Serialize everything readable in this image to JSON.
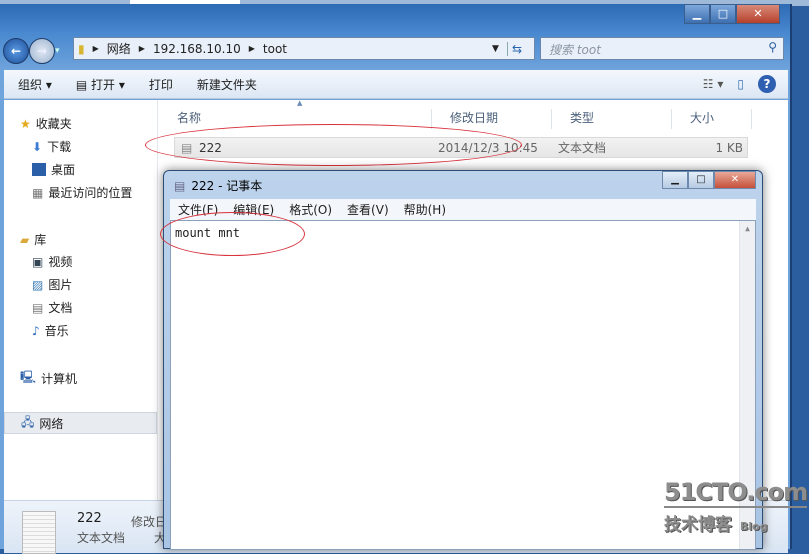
{
  "explorer": {
    "breadcrumb": [
      "网络",
      "192.168.10.10",
      "toot"
    ],
    "search_placeholder": "搜索 toot",
    "toolbar": {
      "organize": "组织 ▾",
      "open": "打开 ▾",
      "print": "打印",
      "new_folder": "新建文件夹"
    },
    "sidebar": {
      "favorites": "收藏夹",
      "downloads": "下载",
      "desktop": "桌面",
      "recent": "最近访问的位置",
      "libraries": "库",
      "videos": "视频",
      "pictures": "图片",
      "documents": "文档",
      "music": "音乐",
      "computer": "计算机",
      "network": "网络"
    },
    "columns": {
      "name": "名称",
      "modified": "修改日期",
      "type": "类型",
      "size": "大小"
    },
    "files": [
      {
        "name": "222",
        "modified": "2014/12/3 10:45",
        "type": "文本文档",
        "size": "1 KB"
      }
    ],
    "details": {
      "name": "222",
      "type": "文本文档",
      "modified_label": "修改日",
      "size_label": "大"
    }
  },
  "notepad": {
    "title": "222 - 记事本",
    "menu": [
      "文件(F)",
      "编辑(E)",
      "格式(O)",
      "查看(V)",
      "帮助(H)"
    ],
    "content": "mount mnt"
  },
  "watermark": {
    "site": "51CTO.com",
    "sub": "技术博客",
    "blog": "Blog"
  },
  "colors": {
    "annotation": "#d8323c",
    "frame": "#2d6bb5"
  }
}
